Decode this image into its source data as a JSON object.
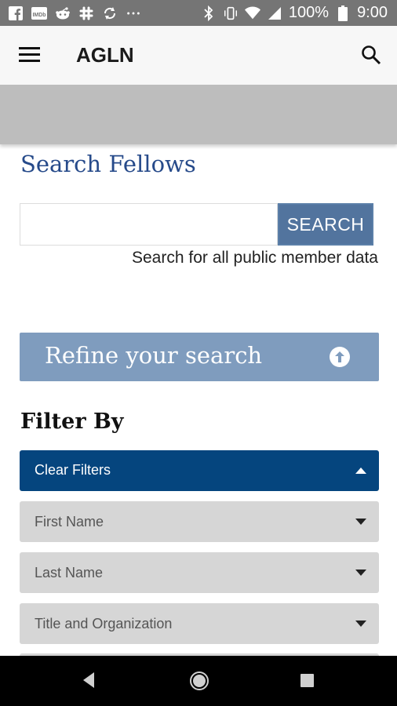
{
  "status_bar": {
    "left_icons": [
      "facebook-icon",
      "imdb-icon",
      "reddit-icon",
      "slack-icon",
      "sync-icon",
      "more-icon"
    ],
    "right_icons": [
      "bluetooth-icon",
      "vibrate-icon",
      "wifi-icon",
      "signal-icon",
      "battery-icon"
    ],
    "battery": "100%",
    "time": "9:00"
  },
  "app_bar": {
    "title": "AGLN",
    "menu_icon": "menu-icon",
    "search_icon": "search-icon"
  },
  "search_section": {
    "title": "Search Fellows",
    "input_value": "",
    "input_placeholder": "",
    "button_label": "SEARCH",
    "help_text": "Search for all public member data"
  },
  "refine": {
    "label": "Refine your search",
    "icon": "arrow-up-circle-icon"
  },
  "filter": {
    "title": "Filter By",
    "clear_label": "Clear Filters",
    "items": [
      {
        "label": "First Name"
      },
      {
        "label": "Last Name"
      },
      {
        "label": "Title and Organization"
      }
    ]
  },
  "colors": {
    "status_bar": "#757575",
    "app_bar": "#f7f7f7",
    "accent_blue": "#264a8a",
    "search_button": "#52749e",
    "refine_bar": "#7f9cbe",
    "clear_bar": "#05457e",
    "filter_item": "#d6d6d6",
    "nav_bar": "#000000"
  }
}
